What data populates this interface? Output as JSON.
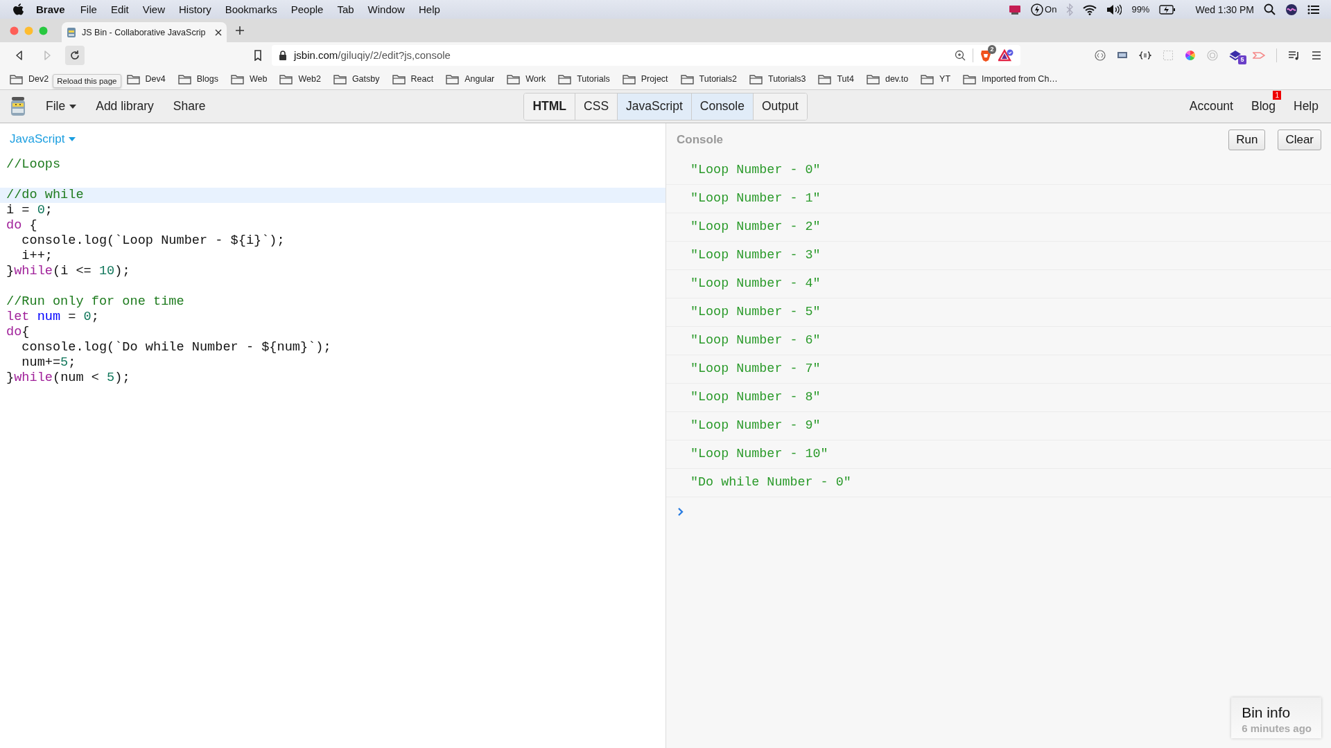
{
  "menubar": {
    "app": "Brave",
    "items": [
      "File",
      "Edit",
      "View",
      "History",
      "Bookmarks",
      "People",
      "Tab",
      "Window",
      "Help"
    ],
    "status": {
      "focus": "On",
      "battery": "99%",
      "clock": "Wed 1:30 PM"
    }
  },
  "browser": {
    "tab": {
      "title": "JS Bin - Collaborative JavaScrip"
    },
    "url": {
      "host": "jsbin.com",
      "path": "/giluqiy/2/edit?js,console"
    },
    "shields_badge": "2",
    "extension_badge": "5",
    "tooltip": "Reload this page",
    "bookmarks": [
      "Dev2",
      "Dev4",
      "Blogs",
      "Web",
      "Web2",
      "Gatsby",
      "React",
      "Angular",
      "Work",
      "Tutorials",
      "Project",
      "Tutorials2",
      "Tutorials3",
      "Tut4",
      "dev.to",
      "YT",
      "Imported from Ch…"
    ]
  },
  "jsbin": {
    "menu": [
      {
        "label": "File",
        "kind": "dropdown"
      },
      {
        "label": "Add library",
        "kind": "link"
      },
      {
        "label": "Share",
        "kind": "link"
      }
    ],
    "panels": [
      {
        "label": "HTML",
        "selected": false,
        "modified": true
      },
      {
        "label": "CSS",
        "selected": false,
        "modified": false
      },
      {
        "label": "JavaScript",
        "selected": true,
        "modified": false
      },
      {
        "label": "Console",
        "selected": true,
        "modified": false
      },
      {
        "label": "Output",
        "selected": false,
        "modified": false
      }
    ],
    "account": [
      {
        "label": "Account"
      },
      {
        "label": "Blog",
        "badge": "1"
      },
      {
        "label": "Help"
      }
    ]
  },
  "editor": {
    "language": "JavaScript",
    "lines": [
      {
        "kind": "code",
        "active": false,
        "tokens": [
          {
            "text": "//Loops",
            "kind": "comment"
          }
        ]
      },
      {
        "kind": "blank",
        "active": false
      },
      {
        "kind": "code",
        "active": true,
        "tokens": [
          {
            "text": "//do while",
            "kind": "comment"
          }
        ]
      },
      {
        "kind": "code",
        "active": false,
        "tokens": [
          {
            "text": "i = ",
            "kind": "plain"
          },
          {
            "text": "0",
            "kind": "number"
          },
          {
            "text": ";",
            "kind": "plain"
          }
        ]
      },
      {
        "kind": "code",
        "active": false,
        "tokens": [
          {
            "text": "do",
            "kind": "keyword"
          },
          {
            "text": " {",
            "kind": "plain"
          }
        ]
      },
      {
        "kind": "code",
        "active": false,
        "tokens": [
          {
            "text": "  console.log(`Loop Number - ${i}`);",
            "kind": "plain"
          }
        ]
      },
      {
        "kind": "code",
        "active": false,
        "tokens": [
          {
            "text": "  i++;",
            "kind": "plain"
          }
        ]
      },
      {
        "kind": "code",
        "active": false,
        "tokens": [
          {
            "text": "}",
            "kind": "plain"
          },
          {
            "text": "while",
            "kind": "keyword"
          },
          {
            "text": "(i <= ",
            "kind": "plain"
          },
          {
            "text": "10",
            "kind": "number"
          },
          {
            "text": ");",
            "kind": "plain"
          }
        ]
      },
      {
        "kind": "blank",
        "active": false
      },
      {
        "kind": "code",
        "active": false,
        "tokens": [
          {
            "text": "//Run only for one time",
            "kind": "comment"
          }
        ]
      },
      {
        "kind": "code",
        "active": false,
        "tokens": [
          {
            "text": "let ",
            "kind": "keyword"
          },
          {
            "text": "num",
            "kind": "variable"
          },
          {
            "text": " = ",
            "kind": "plain"
          },
          {
            "text": "0",
            "kind": "number"
          },
          {
            "text": ";",
            "kind": "plain"
          }
        ]
      },
      {
        "kind": "code",
        "active": false,
        "tokens": [
          {
            "text": "do",
            "kind": "keyword"
          },
          {
            "text": "{",
            "kind": "plain"
          }
        ]
      },
      {
        "kind": "code",
        "active": false,
        "tokens": [
          {
            "text": "  console.log(`Do while Number - ${num}`);",
            "kind": "plain"
          }
        ]
      },
      {
        "kind": "code",
        "active": false,
        "tokens": [
          {
            "text": "  num+=",
            "kind": "plain"
          },
          {
            "text": "5",
            "kind": "number"
          },
          {
            "text": ";",
            "kind": "plain"
          }
        ]
      },
      {
        "kind": "code",
        "active": false,
        "tokens": [
          {
            "text": "}",
            "kind": "plain"
          },
          {
            "text": "while",
            "kind": "keyword"
          },
          {
            "text": "(num < ",
            "kind": "plain"
          },
          {
            "text": "5",
            "kind": "number"
          },
          {
            "text": ");",
            "kind": "plain"
          }
        ]
      }
    ]
  },
  "console": {
    "title": "Console",
    "buttons": [
      "Run",
      "Clear"
    ],
    "logs": [
      "\"Loop Number - 0\"",
      "\"Loop Number - 1\"",
      "\"Loop Number - 2\"",
      "\"Loop Number - 3\"",
      "\"Loop Number - 4\"",
      "\"Loop Number - 5\"",
      "\"Loop Number - 6\"",
      "\"Loop Number - 7\"",
      "\"Loop Number - 8\"",
      "\"Loop Number - 9\"",
      "\"Loop Number - 10\"",
      "\"Do while Number - 0\""
    ]
  },
  "bin_info": {
    "title": "Bin info",
    "time": "6 minutes ago"
  }
}
